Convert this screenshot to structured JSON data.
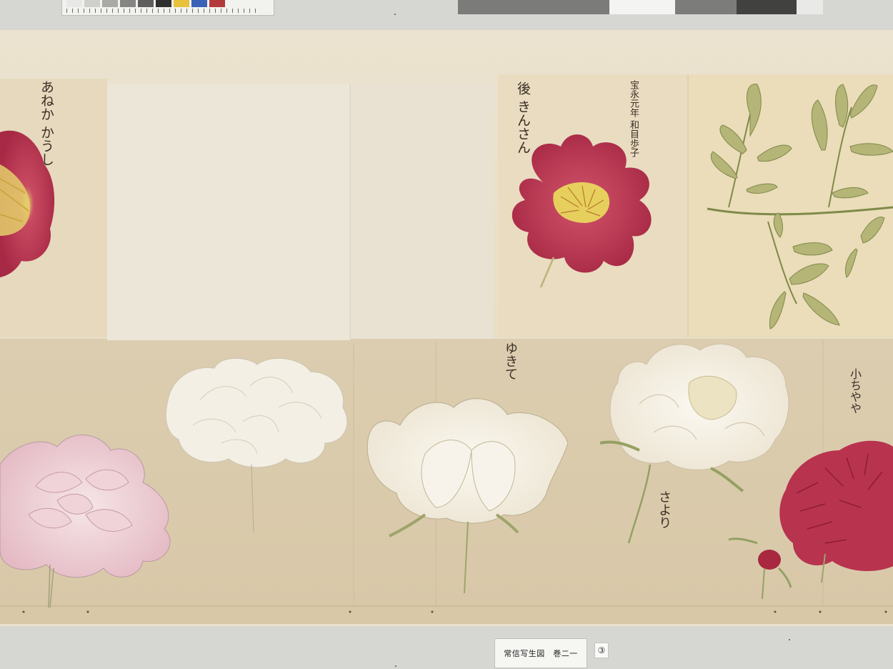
{
  "calligraphy": {
    "label_1": "あねか かうし",
    "label_2": "後 きんさん",
    "label_3": "宝永元年 和目歩子",
    "label_4": "ゆきて",
    "label_5": "小ちやや",
    "label_6": "さより"
  },
  "catalog_label": "常信写生図　巻二一",
  "plate_number": "③",
  "colors": {
    "paper_top": "#ebe3cf",
    "paper_bottom": "#d9c9aa",
    "crimson_peony": "#b3344f",
    "pink_peony": "#e9c3cc",
    "white_peony": "#f4efe4",
    "leaf_green": "#a8ad6c"
  }
}
